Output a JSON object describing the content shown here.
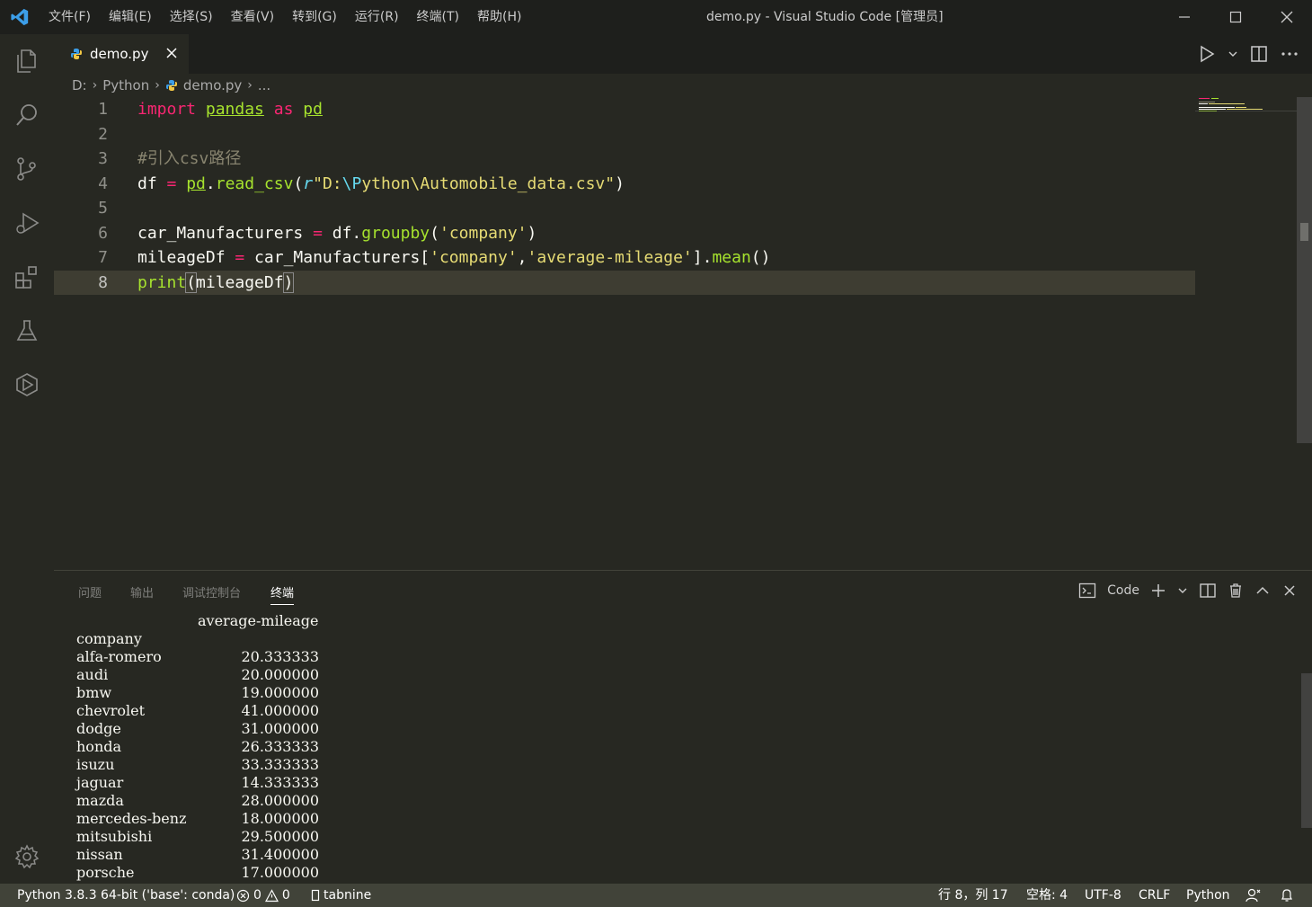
{
  "window": {
    "title": "demo.py - Visual Studio Code [管理员]",
    "menu": [
      "文件(F)",
      "编辑(E)",
      "选择(S)",
      "查看(V)",
      "转到(G)",
      "运行(R)",
      "终端(T)",
      "帮助(H)"
    ]
  },
  "activity": [
    "explorer-icon",
    "search-icon",
    "source-control-icon",
    "run-debug-icon",
    "extensions-icon",
    "testing-icon",
    "remote-icon",
    "settings-gear-icon"
  ],
  "editor": {
    "tab": {
      "label": "demo.py"
    },
    "breadcrumb": {
      "drive": "D:",
      "folder": "Python",
      "file": "demo.py",
      "more": "..."
    },
    "current_line": 8,
    "lines": [
      {
        "n": "1"
      },
      {
        "n": "2"
      },
      {
        "n": "3"
      },
      {
        "n": "4"
      },
      {
        "n": "5"
      },
      {
        "n": "6"
      },
      {
        "n": "7"
      },
      {
        "n": "8"
      }
    ],
    "code": {
      "l1_import": "import",
      "l1_pandas": "pandas",
      "l1_as": "as",
      "l1_pd": "pd",
      "l3_comment": "#引入csv路径",
      "l4_df": "df ",
      "l4_eq": "=",
      "l4_pd": "pd",
      "l4_dot": ".",
      "l4_fn": "read_csv",
      "l4_open": "(",
      "l4_r": "r",
      "l4_str1": "\"D:",
      "l4_esc": "\\P",
      "l4_str2": "ython\\Automobile_data.csv\"",
      "l4_close": ")",
      "l6_var": "car_Manufacturers ",
      "l6_eq": "=",
      "l6_df": " df.",
      "l6_fn": "groupby",
      "l6_open": "(",
      "l6_str": "'company'",
      "l6_close": ")",
      "l7_var": "mileageDf ",
      "l7_eq": "=",
      "l7_rest": " car_Manufacturers[",
      "l7_s1": "'company'",
      "l7_comma": ",",
      "l7_s2": "'average-mileage'",
      "l7_br": "].",
      "l7_fn": "mean",
      "l7_end": "()",
      "l8_fn": "print",
      "l8_open": "(",
      "l8_arg": "mileageDf",
      "l8_close": ")"
    }
  },
  "panel": {
    "tabs": [
      "问题",
      "输出",
      "调试控制台",
      "终端"
    ],
    "active_tab": "终端",
    "terminal_name": "Code",
    "header": "average-mileage",
    "index_name": "company",
    "rows": [
      {
        "company": "alfa-romero",
        "value": "20.333333"
      },
      {
        "company": "audi",
        "value": "20.000000"
      },
      {
        "company": "bmw",
        "value": "19.000000"
      },
      {
        "company": "chevrolet",
        "value": "41.000000"
      },
      {
        "company": "dodge",
        "value": "31.000000"
      },
      {
        "company": "honda",
        "value": "26.333333"
      },
      {
        "company": "isuzu",
        "value": "33.333333"
      },
      {
        "company": "jaguar",
        "value": "14.333333"
      },
      {
        "company": "mazda",
        "value": "28.000000"
      },
      {
        "company": "mercedes-benz",
        "value": "18.000000"
      },
      {
        "company": "mitsubishi",
        "value": "29.500000"
      },
      {
        "company": "nissan",
        "value": "31.400000"
      },
      {
        "company": "porsche",
        "value": "17.000000"
      }
    ]
  },
  "status": {
    "interpreter": "Python 3.8.3 64-bit ('base': conda)",
    "errors": "0",
    "warnings": "0",
    "tabnine": "tabnine",
    "position": "行 8，列 17",
    "spaces": "空格: 4",
    "encoding": "UTF-8",
    "eol": "CRLF",
    "language": "Python"
  },
  "colors": {
    "editor_bg": "#272822",
    "keyword": "#f92672",
    "function": "#a6e22e",
    "string": "#e6db74",
    "comment": "#88846f",
    "statusbar": "#414339"
  }
}
